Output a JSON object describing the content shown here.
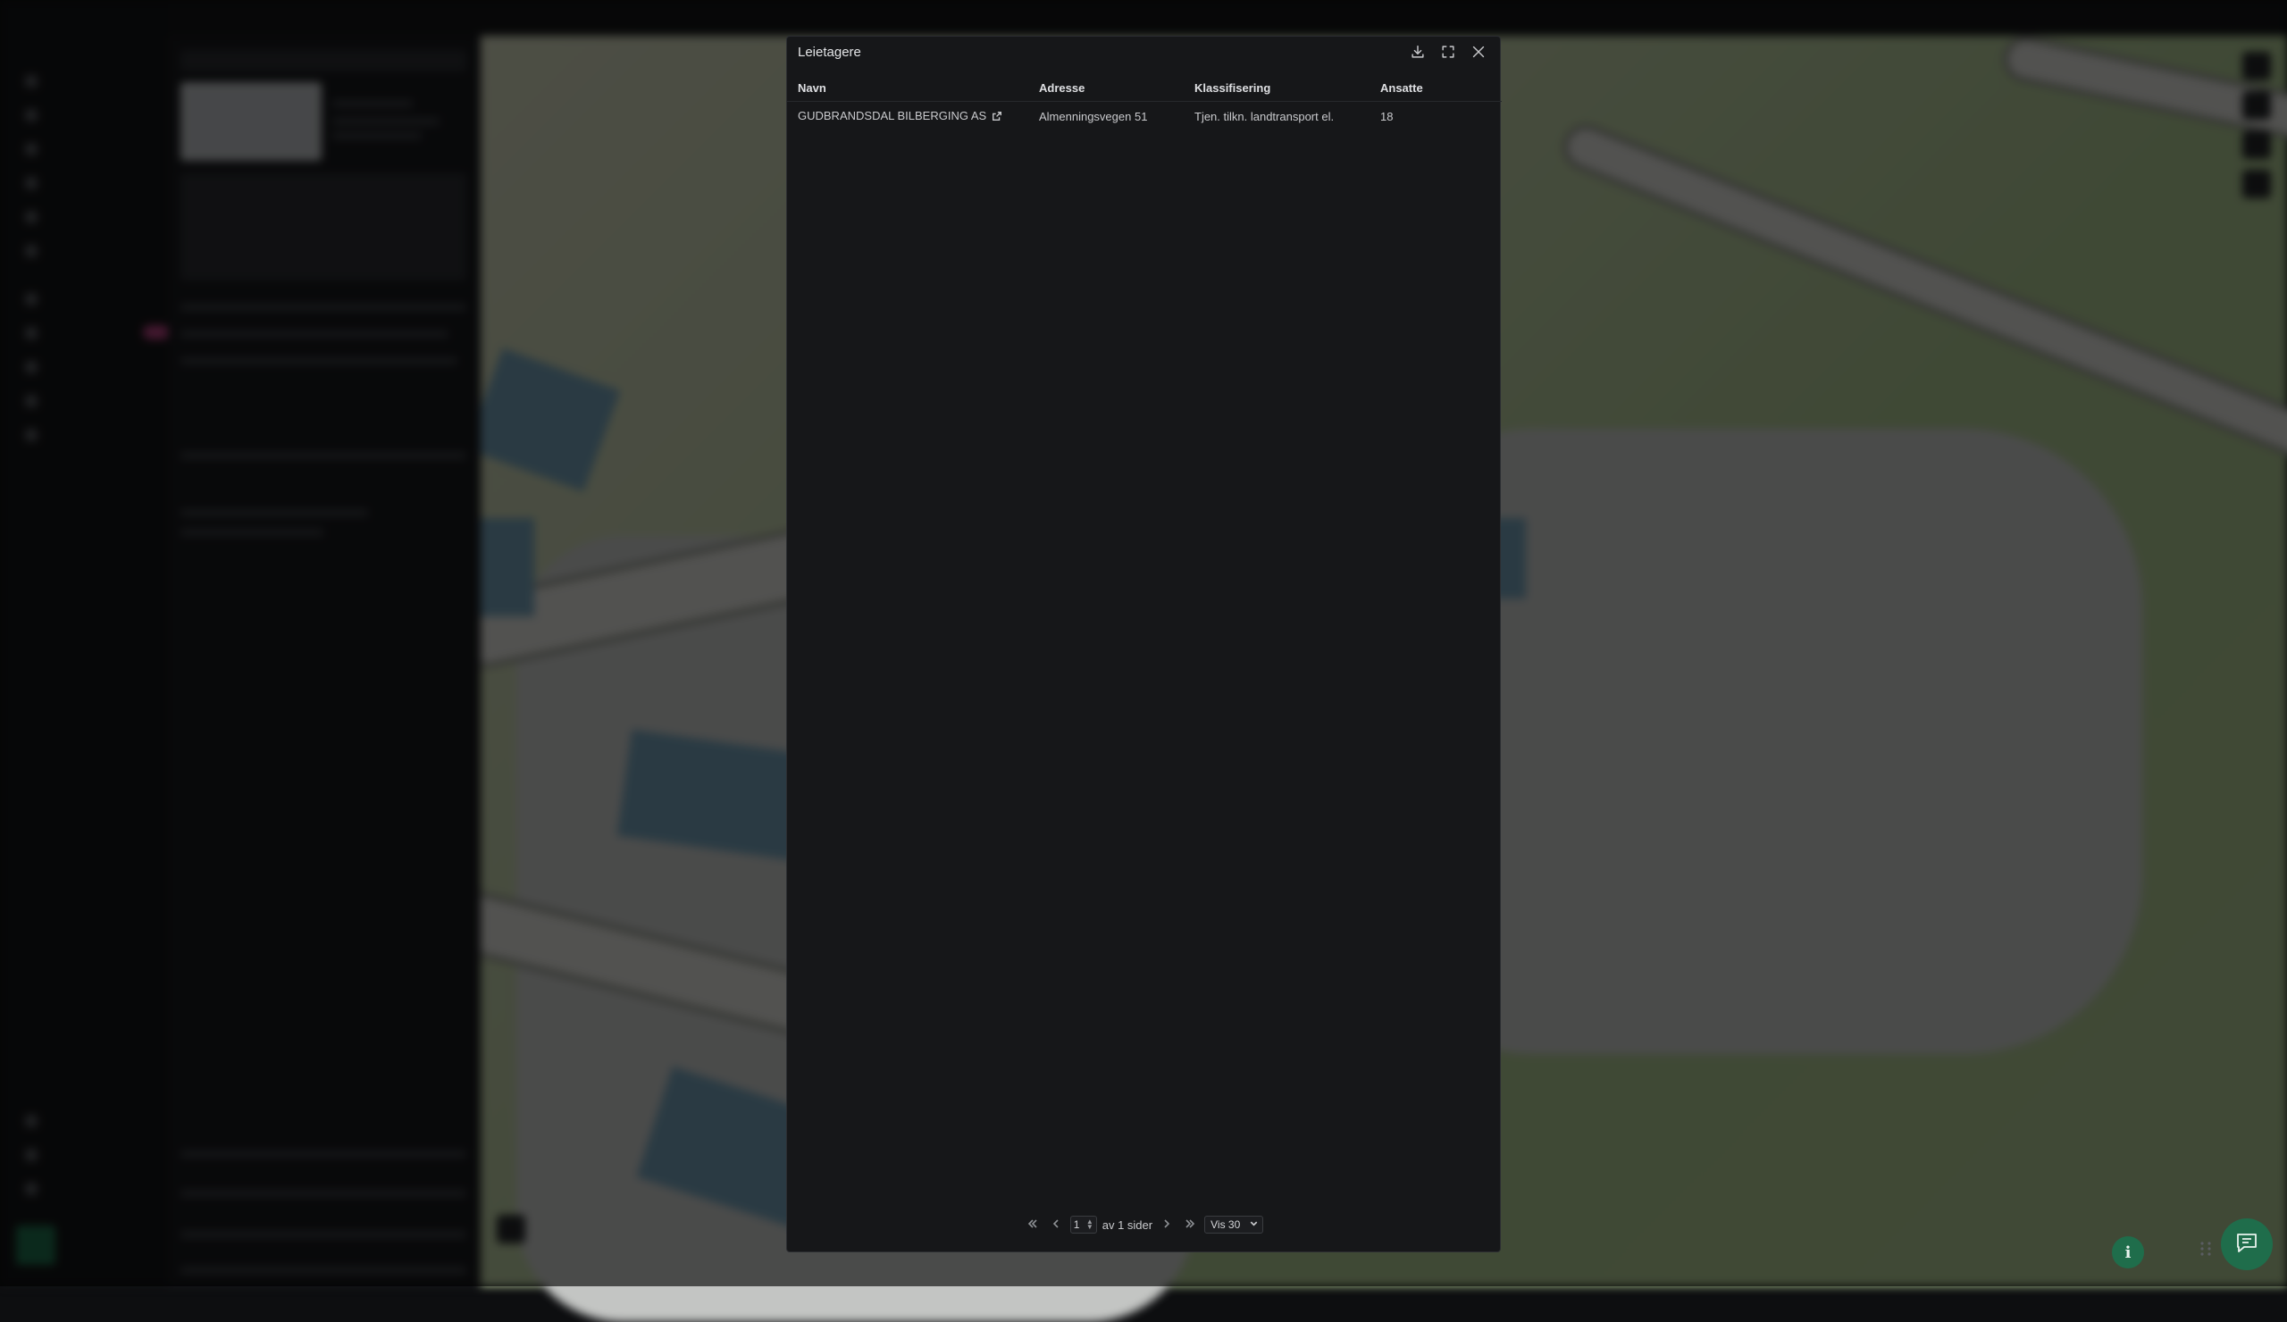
{
  "modal": {
    "title": "Leietagere",
    "actions": {
      "download_icon": "download-icon",
      "fullscreen_icon": "expand-icon",
      "close_icon": "close-icon"
    },
    "table": {
      "columns": [
        "Navn",
        "Adresse",
        "Klassifisering",
        "Ansatte"
      ],
      "rows": [
        {
          "navn": "GUDBRANDSDAL BILBERGING AS",
          "adresse": "Almenningsvegen 51",
          "klassifisering": "Tjen. tilkn. landtransport el.",
          "ansatte": "18"
        }
      ]
    },
    "pagination": {
      "current_page": "1",
      "of_pages_label": "av 1 sider",
      "page_size_label": "Vis 30"
    }
  },
  "floating": {
    "info_icon": "info-icon",
    "chat_icon": "chat-icon"
  },
  "colors": {
    "modal_bg": "#161719",
    "accent_green": "#1f6d4b",
    "nav_badge": "#b0407c"
  }
}
